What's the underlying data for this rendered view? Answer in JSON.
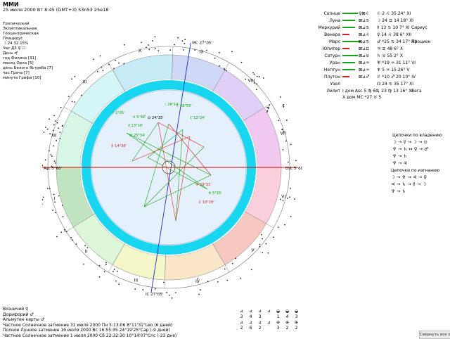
{
  "header": {
    "title": "ММИ",
    "subtitle": "25 июля 2000  Вт  8:45 (GMT+3) 53n53  25e18"
  },
  "info_lines": [
    "Тропический",
    "Эклиптикальная",
    "Геоцентрическая",
    "Плацидус",
    "☽  24 32.15%",
    "Час Д3 ♀ ☐",
    "День ♂",
    "год Филина [31]",
    "месяц Орла [5]",
    "день Белого Ястреба [7]",
    "час Грача [7]",
    "минута Грифа [10]"
  ],
  "planets": [
    {
      "name": "Солнце",
      "bar_color": "#18a018",
      "bar": "lg",
      "sym": "♀⊠♌",
      "val": "☉  2 ♌ 35  24° XI",
      "note": ""
    },
    {
      "name": "Луна",
      "bar_color": "#18a018",
      "bar": "md",
      "sym": "⊠⊿♋",
      "val": "☽  24 ♊ 14  18° XI",
      "note": ""
    },
    {
      "name": "Меркурий",
      "bar_color": "#18a018",
      "bar": "md",
      "sym": "⊠⊿♋",
      "val": "☿  13 ♋ 10   7° XI",
      "note": "Сириус"
    },
    {
      "name": "Венера",
      "bar_color": "#d02020",
      "bar": "sm",
      "sym": "⊠⊿♌",
      "val": "♀  14 ♌ 38   6° XII",
      "note": ""
    },
    {
      "name": "Марс",
      "bar_color": "#18a018",
      "bar": "xl",
      "sym": "⊠⊿♋",
      "val": "♂ *25 ♋ 34  17° XII",
      "note": "Процион"
    },
    {
      "name": "Юпитер",
      "bar_color": "#d02020",
      "bar": "sm",
      "sym": "⊠⊿♊",
      "val": "♃  ♊ 48   6° X",
      "note": ""
    },
    {
      "name": "Сатурн",
      "bar_color": "#18a018",
      "bar": "lg",
      "sym": "⊠⊿♉",
      "val": "♄  ♉ 55   2° X",
      "note": ""
    },
    {
      "name": "Уран",
      "bar_color": "#18a018",
      "bar": "md",
      "sym": "⊠⊿♒",
      "val": "♅ *19 ♒ 31  11° VI",
      "note": ""
    },
    {
      "name": "Нептун",
      "bar_color": "#18a018",
      "bar": "md",
      "sym": "⊠⊿♒",
      "val": "♆  5 ♒ 15  26° V",
      "note": ""
    },
    {
      "name": "Плутон",
      "bar_color": "#d02020",
      "bar": "sm",
      "sym": "⊠⊿♐",
      "val": "♇ *10 ♐ 20  10° IV",
      "note": ""
    },
    {
      "name": "Узел",
      "bar_color": "#000000",
      "bar": "none",
      "sym": "",
      "val": "☊  24 ♋ 35  17° XI",
      "note": ""
    },
    {
      "name": "Лилит",
      "bar_color": "#000000",
      "bar": "none",
      "sym": "",
      "val": "⚸  23 ♍ 13  16° XI",
      "note": "Вега"
    }
  ],
  "houses_info": [
    "I дом     Asc  5 ♍ 60",
    "X дом     MC  *27 ♉ 5"
  ],
  "chains1": {
    "title": "Цепочки по владению",
    "lines": [
      "☽ → ☿ → ☽ → ⊙",
      "♆ → ♄ ↔ ♀ → ♂",
      "♆ → ♄",
      "♆ → ♃"
    ]
  },
  "chains2": {
    "title": "Цепочки по изгнанию",
    "lines": [
      "☽ → ♆ → ♃ → ♀",
      "♃ → ♄ → ☿ → ☽",
      "♆ → ♄"
    ]
  },
  "bottom_info": [
    "Возничий  ♀",
    "Дорифорий  ♂",
    "Альмутен карты  ♂",
    "Частное Солнечное затмение 31 июля 2000 Пн  5:13:06  8°11'31\"Leo (6 дней)",
    "Полное Лунное затмение 16 июля 2000 Вс 16:55:35 24°19'25\"Cap (-9 дней)",
    "Частное Солнечное затмение 1 июля 2000 Сб 22:32:30 10°14'07\"Cnc (-23 дня)"
  ],
  "elements": {
    "row1_icons": [
      "⊿",
      "⊿",
      "⊿",
      "⊿",
      "◒",
      "◒",
      "◒"
    ],
    "row1_vals": [
      "3",
      "4",
      "3",
      "",
      "1",
      "4",
      "3"
    ],
    "row2_icons": [
      "⊿",
      "⊿",
      "⊿",
      "⊿",
      "⊕",
      "⊕",
      "⊕"
    ],
    "row2_vals": [
      "2",
      "6",
      "2",
      "",
      "3",
      "2",
      "2"
    ]
  },
  "chart_labels": {
    "asc": "Asc 5°60'",
    "dsc": "Dsc 5°60'",
    "mc": "MC 27°05'",
    "ic": "IC 27°05'",
    "house_numbers": [
      "I",
      "II",
      "III",
      "IV",
      "V",
      "VI",
      "VII",
      "VIII",
      "IX",
      "X",
      "XI",
      "XII"
    ],
    "planet_labels": [
      {
        "t": "☉ 2°35'",
        "c": "#0a0"
      },
      {
        "t": "☽ 24°14'",
        "c": "#0a0"
      },
      {
        "t": "☿ 13°10'",
        "c": "#0a0"
      },
      {
        "t": "♀ 14°38'",
        "c": "#d02020"
      },
      {
        "t": "♂ 25°34'",
        "c": "#0a0"
      },
      {
        "t": "♃ 5°48'",
        "c": "#0a0"
      },
      {
        "t": "♄ 28°55'",
        "c": "#0a0"
      },
      {
        "t": "♅ 19°31'",
        "c": "#d02020"
      },
      {
        "t": "♆ 5°15'",
        "c": "#0a0"
      },
      {
        "t": "♇ 10°20'",
        "c": "#d02020"
      },
      {
        "t": "☊ 24°35'",
        "c": "#000"
      },
      {
        "t": "⚸ 12°24'",
        "c": "#0a0"
      }
    ]
  },
  "scroll_button": "Свернуть все окна",
  "colors": {
    "ring_cyan": "#19d6f0",
    "asc_axis": "#e00000",
    "mc_axis": "#1030c0",
    "aspect_green": "#10a010",
    "aspect_red": "#e02020"
  }
}
